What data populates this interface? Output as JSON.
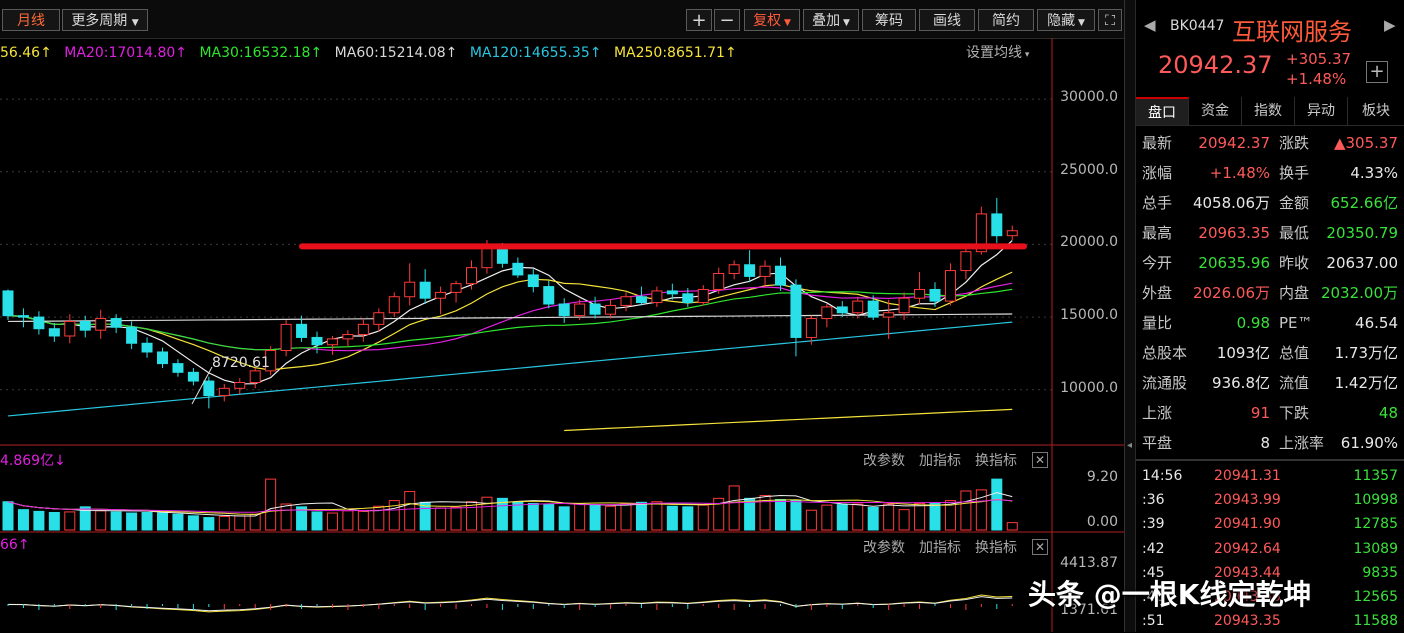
{
  "toolbar": {
    "period_label": "月线",
    "more_period_label": "更多周期",
    "zoom_in": "+",
    "zoom_out": "−",
    "adjust_label": "复权",
    "overlay_label": "叠加",
    "chips_label": "筹码",
    "draw_label": "画线",
    "simple_label": "简约",
    "hide_label": "隐藏"
  },
  "ma_legend": {
    "ma10": "56.46",
    "ma20": "MA20:17014.80",
    "ma30": "MA30:16532.18",
    "ma60": "MA60:15214.08",
    "ma120": "MA120:14655.35",
    "ma250": "MA250:8651.71",
    "settings": "设置均线"
  },
  "colors": {
    "up": "#ff3a3a",
    "down": "#29e0e8",
    "ma5": "#f0f0f0",
    "ma10": "#f5e33b",
    "ma20": "#e020e0",
    "ma30": "#2ee62e",
    "ma60": "#d8d8d8",
    "ma120": "#29c6e0",
    "ma250": "#f5e33b",
    "resistance_line": "#e8101a"
  },
  "price_axis": [
    "30000.0",
    "25000.0",
    "20000.0",
    "15000.0",
    "10000.0"
  ],
  "low_marker": "8720.61",
  "volume_pane": {
    "label": "4.869亿",
    "change_params": "改参数",
    "add_indicator": "加指标",
    "switch_indicator": "换指标",
    "axis_top": "9.20",
    "axis_bottom": "0.00"
  },
  "indicator_pane": {
    "label": "66",
    "change_params": "改参数",
    "add_indicator": "加指标",
    "switch_indicator": "换指标",
    "axis_top": "4413.87",
    "axis_bottom": "1371.61"
  },
  "chart_data": {
    "type": "candlestick",
    "ohlc": [
      [
        16800,
        16900,
        14800,
        15100
      ],
      [
        15100,
        15600,
        14300,
        15000
      ],
      [
        15000,
        15400,
        13800,
        14200
      ],
      [
        14200,
        14600,
        13300,
        13700
      ],
      [
        13700,
        15200,
        13200,
        14700
      ],
      [
        14700,
        15100,
        13600,
        14100
      ],
      [
        14100,
        15500,
        13500,
        14900
      ],
      [
        14900,
        15200,
        13900,
        14300
      ],
      [
        14300,
        14700,
        12800,
        13200
      ],
      [
        13200,
        13600,
        12200,
        12600
      ],
      [
        12600,
        12900,
        11500,
        11800
      ],
      [
        11800,
        12100,
        10900,
        11200
      ],
      [
        11200,
        11500,
        10300,
        10600
      ],
      [
        10600,
        10900,
        8720,
        9600
      ],
      [
        9600,
        10400,
        9200,
        10100
      ],
      [
        10100,
        10800,
        9700,
        10500
      ],
      [
        10500,
        11500,
        10100,
        11300
      ],
      [
        11300,
        13000,
        11000,
        12700
      ],
      [
        12700,
        14800,
        12300,
        14500
      ],
      [
        14500,
        15100,
        13300,
        13600
      ],
      [
        13600,
        14000,
        12500,
        13100
      ],
      [
        13100,
        13700,
        12400,
        13500
      ],
      [
        13500,
        14100,
        13000,
        13800
      ],
      [
        13800,
        14900,
        13300,
        14500
      ],
      [
        14500,
        15600,
        14000,
        15300
      ],
      [
        15300,
        16700,
        15000,
        16400
      ],
      [
        16400,
        18700,
        15800,
        17400
      ],
      [
        17400,
        18300,
        15900,
        16300
      ],
      [
        16300,
        17100,
        15200,
        16700
      ],
      [
        16700,
        17500,
        16000,
        17300
      ],
      [
        17300,
        18900,
        16900,
        18400
      ],
      [
        18400,
        20300,
        18000,
        19800
      ],
      [
        19800,
        20100,
        18400,
        18700
      ],
      [
        18700,
        19100,
        17700,
        17900
      ],
      [
        17900,
        18300,
        16700,
        17100
      ],
      [
        17100,
        17500,
        15600,
        15900
      ],
      [
        15900,
        16300,
        14600,
        15100
      ],
      [
        15100,
        16200,
        14800,
        15900
      ],
      [
        15900,
        16400,
        14900,
        15200
      ],
      [
        15200,
        16200,
        14900,
        15800
      ],
      [
        15800,
        16700,
        15400,
        16400
      ],
      [
        16400,
        17100,
        15800,
        16000
      ],
      [
        16000,
        17100,
        15700,
        16800
      ],
      [
        16800,
        17300,
        16200,
        16600
      ],
      [
        16600,
        17000,
        15700,
        16000
      ],
      [
        16000,
        17200,
        15800,
        16900
      ],
      [
        16900,
        18400,
        16600,
        18000
      ],
      [
        18000,
        18900,
        17600,
        18600
      ],
      [
        18600,
        19600,
        17400,
        17800
      ],
      [
        17800,
        18900,
        17100,
        18500
      ],
      [
        18500,
        19100,
        16800,
        17200
      ],
      [
        17200,
        17600,
        12300,
        13600
      ],
      [
        13600,
        15100,
        13100,
        14900
      ],
      [
        14900,
        15900,
        14300,
        15700
      ],
      [
        15700,
        16100,
        15000,
        15300
      ],
      [
        15300,
        16400,
        14900,
        16100
      ],
      [
        16100,
        16500,
        14800,
        15000
      ],
      [
        15000,
        16200,
        13500,
        15300
      ],
      [
        15300,
        16700,
        14800,
        16300
      ],
      [
        16300,
        18100,
        15900,
        16900
      ],
      [
        16900,
        17400,
        15700,
        16100
      ],
      [
        16100,
        18700,
        15800,
        18200
      ],
      [
        18200,
        19800,
        17600,
        19500
      ],
      [
        19500,
        22600,
        19300,
        22100
      ],
      [
        22100,
        23200,
        20100,
        20600
      ],
      [
        20600,
        21300,
        20300,
        20942
      ]
    ],
    "series": [
      {
        "name": "MA20",
        "value": 17014.8
      },
      {
        "name": "MA30",
        "value": 16532.18
      },
      {
        "name": "MA60",
        "value": 15214.08
      },
      {
        "name": "MA120",
        "value": 14655.35
      },
      {
        "name": "MA250",
        "value": 8651.71
      }
    ],
    "ylim": [
      6200,
      32000
    ],
    "resistance_level": 20000,
    "volume": [
      5.0,
      3.6,
      3.3,
      3.1,
      3.2,
      4.1,
      3.4,
      3.2,
      3.0,
      3.1,
      3.0,
      2.8,
      2.5,
      2.2,
      2.4,
      2.5,
      2.8,
      9.0,
      4.6,
      4.1,
      3.2,
      3.0,
      3.4,
      3.3,
      4.2,
      5.2,
      6.8,
      4.9,
      3.9,
      4.0,
      5.0,
      5.8,
      5.6,
      4.9,
      4.7,
      4.6,
      4.1,
      4.6,
      4.5,
      4.2,
      4.6,
      4.9,
      5.0,
      4.2,
      4.1,
      4.4,
      5.6,
      7.8,
      5.6,
      6.1,
      5.4,
      5.3,
      3.5,
      4.4,
      4.5,
      4.6,
      4.0,
      4.6,
      3.6,
      4.7,
      4.8,
      5.2,
      6.9,
      7.1,
      9.0,
      1.3
    ],
    "volume_ylim": [
      0,
      9.2
    ]
  },
  "panel": {
    "code": "BK0447",
    "name": "互联网服务",
    "price": "20942.37",
    "change": "+305.37",
    "change_pct": "+1.48%",
    "tabs": [
      "盘口",
      "资金",
      "指数",
      "异动",
      "板块"
    ],
    "quote": [
      {
        "l1": "最新",
        "v1": "20942.37",
        "c1": "red",
        "l2": "涨跌",
        "v2": "▲305.37",
        "c2": "red"
      },
      {
        "l1": "涨幅",
        "v1": "+1.48%",
        "c1": "red",
        "l2": "换手",
        "v2": "4.33%",
        "c2": "white"
      },
      {
        "l1": "总手",
        "v1": "4058.06万",
        "c1": "white",
        "l2": "金额",
        "v2": "652.66亿",
        "c2": "green"
      },
      {
        "l1": "最高",
        "v1": "20963.35",
        "c1": "red",
        "l2": "最低",
        "v2": "20350.79",
        "c2": "green"
      },
      {
        "l1": "今开",
        "v1": "20635.96",
        "c1": "green",
        "l2": "昨收",
        "v2": "20637.00",
        "c2": "white"
      },
      {
        "l1": "外盘",
        "v1": "2026.06万",
        "c1": "red",
        "l2": "内盘",
        "v2": "2032.00万",
        "c2": "green"
      },
      {
        "l1": "量比",
        "v1": "0.98",
        "c1": "green",
        "l2": "PE™",
        "v2": "46.54",
        "c2": "white"
      },
      {
        "l1": "总股本",
        "v1": "1093亿",
        "c1": "white",
        "l2": "总值",
        "v2": "1.73万亿",
        "c2": "white"
      },
      {
        "l1": "流通股",
        "v1": "936.8亿",
        "c1": "white",
        "l2": "流值",
        "v2": "1.42万亿",
        "c2": "white"
      },
      {
        "l1": "上涨",
        "v1": "91",
        "c1": "red",
        "l2": "下跌",
        "v2": "48",
        "c2": "green"
      },
      {
        "l1": "平盘",
        "v1": "8",
        "c1": "white",
        "l2": "上涨率",
        "v2": "61.90%",
        "c2": "white"
      }
    ],
    "ticks": [
      {
        "t": "14:56",
        "p": "20941.31",
        "v": "11357"
      },
      {
        "t": ":36",
        "p": "20943.99",
        "v": "10998"
      },
      {
        "t": ":39",
        "p": "20941.90",
        "v": "12785"
      },
      {
        "t": ":42",
        "p": "20942.64",
        "v": "13089"
      },
      {
        "t": ":45",
        "p": "20943.44",
        "v": "9835"
      },
      {
        "t": ":48",
        "p": "20943.66",
        "v": "12565"
      },
      {
        "t": ":51",
        "p": "20943.35",
        "v": "11588"
      }
    ]
  },
  "watermark": "头条 @一根K线定乾坤"
}
